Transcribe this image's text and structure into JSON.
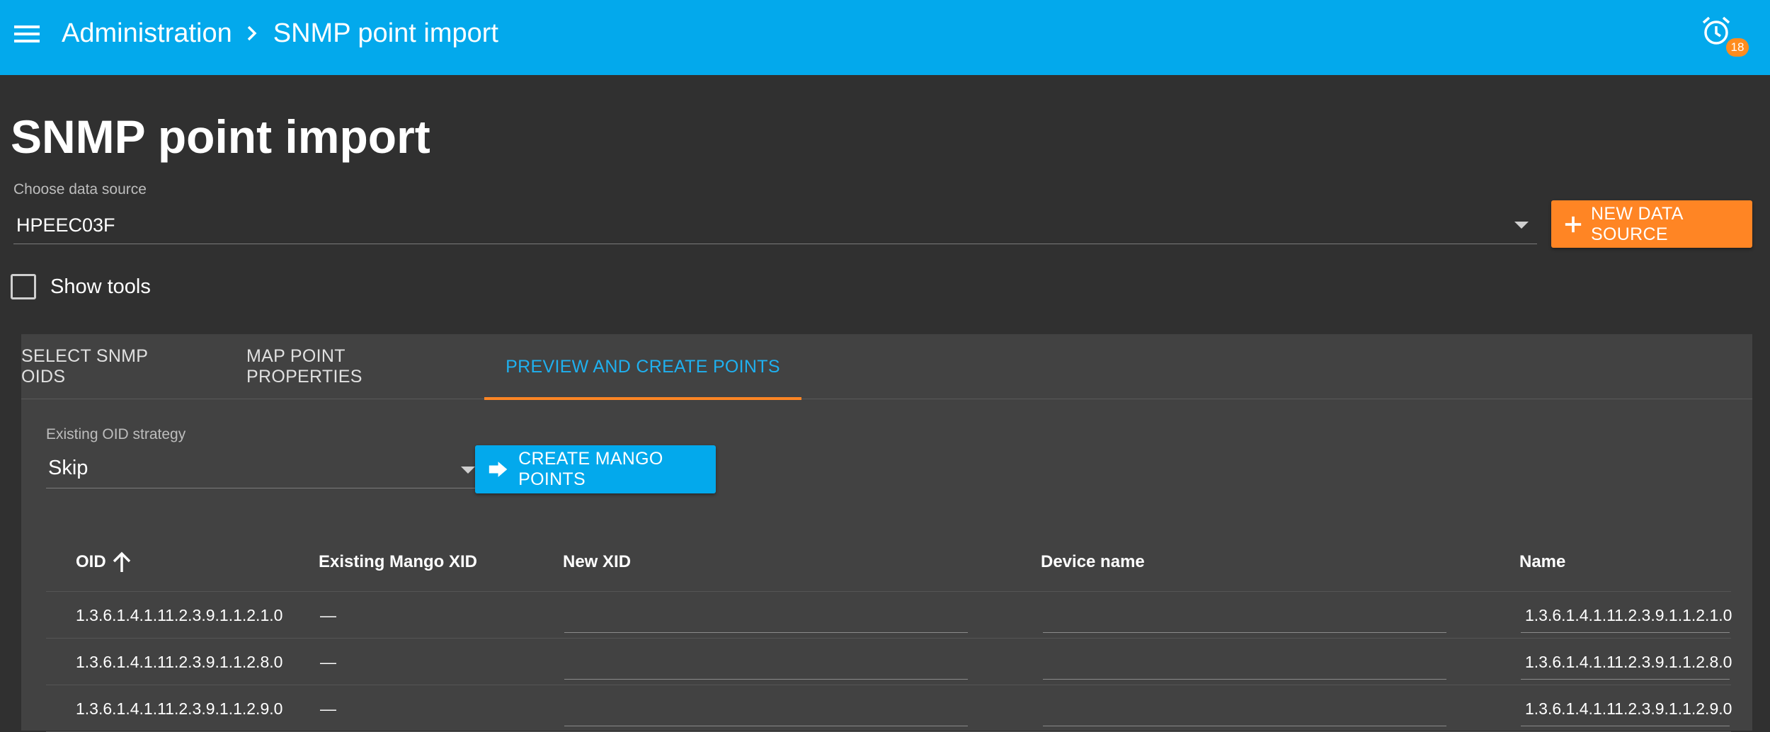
{
  "header": {
    "breadcrumb": [
      "Administration",
      "SNMP point import"
    ],
    "alarm_count": "18",
    "bg_color": "#03a9ec"
  },
  "page": {
    "title": "SNMP point import",
    "data_source_label": "Choose data source",
    "data_source_value": "HPEEC03F",
    "new_data_source_label": "NEW DATA SOURCE",
    "show_tools_label": "Show tools"
  },
  "tabs": [
    {
      "label": "SELECT SNMP OIDS",
      "active": false
    },
    {
      "label": "MAP POINT PROPERTIES",
      "active": false
    },
    {
      "label": "PREVIEW AND CREATE POINTS",
      "active": true
    }
  ],
  "preview": {
    "oid_strategy_label": "Existing OID strategy",
    "oid_strategy_value": "Skip",
    "create_button_label": "CREATE MANGO POINTS"
  },
  "table": {
    "columns": [
      "OID",
      "Existing Mango XID",
      "New XID",
      "Device name",
      "Name"
    ],
    "rows": [
      {
        "oid": "1.3.6.1.4.1.11.2.3.9.1.1.2.1.0",
        "existing_xid": "—",
        "new_xid": "",
        "device_name": "",
        "name": "1.3.6.1.4.1.11.2.3.9.1.1.2.1.0"
      },
      {
        "oid": "1.3.6.1.4.1.11.2.3.9.1.1.2.8.0",
        "existing_xid": "—",
        "new_xid": "",
        "device_name": "",
        "name": "1.3.6.1.4.1.11.2.3.9.1.1.2.8.0"
      },
      {
        "oid": "1.3.6.1.4.1.11.2.3.9.1.1.2.9.0",
        "existing_xid": "—",
        "new_xid": "",
        "device_name": "",
        "name": "1.3.6.1.4.1.11.2.3.9.1.1.2.9.0"
      }
    ]
  },
  "colors": {
    "accent_orange": "#ff8524",
    "accent_blue": "#03a9ec",
    "background": "#303030",
    "card": "#424242"
  }
}
